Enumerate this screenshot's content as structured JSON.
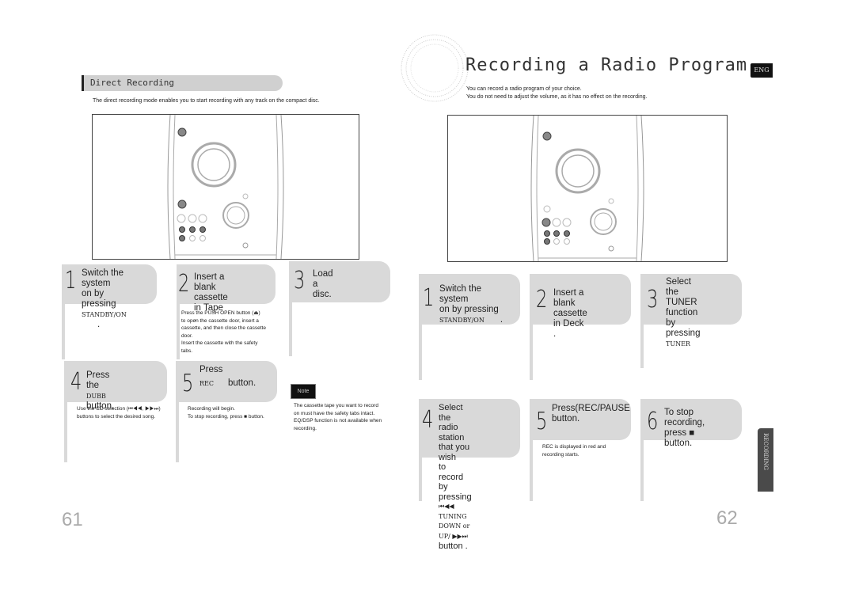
{
  "left_page": {
    "section_title": "Direct Recording",
    "intro": "The direct recording mode enables you to start recording with any track on the compact disc.",
    "steps": [
      {
        "num": "1",
        "text": [
          "Switch the system",
          "on by pressing"
        ],
        "key": "STANDBY/ON",
        "key_suffix": "."
      },
      {
        "num": "2",
        "text": [
          "Insert a blank",
          "cassette in Tape ."
        ],
        "sub": [
          "Press the PUSH OPEN button (⏏)",
          "to open the cassette door, insert a",
          "cassette, and then close the cassette",
          "door.",
          "Insert the cassette with the safety",
          "tabs."
        ]
      },
      {
        "num": "3",
        "text": [
          "Load a disc."
        ]
      },
      {
        "num": "4",
        "text": [
          "Press the",
          "button."
        ],
        "key": "DUBB",
        "sub": [
          "Use the CD selection (⏮◀◀, ▶▶⏭)",
          "buttons to select the desired song."
        ]
      },
      {
        "num": "5",
        "text": [
          "Press",
          "button."
        ],
        "key": "REC",
        "sub": [
          "Recording will begin.",
          "To stop recording, press ■ button."
        ]
      }
    ],
    "note": {
      "label": "Note",
      "lines": [
        "The cassette tape you want to record",
        "on must have the safety tabs intact.",
        "EQ/DSP function is not available when",
        " recording."
      ]
    },
    "page_number": "61"
  },
  "right_page": {
    "title": "Recording a Radio Program",
    "intro": [
      "You can record a radio program of your choice.",
      "You do not need to adjust the volume, as it has no effect on the recording."
    ],
    "lang_tab": "ENG",
    "side_tab": "RECORDING",
    "steps": [
      {
        "num": "1",
        "text": [
          "Switch the system",
          "on by pressing"
        ],
        "key": "STANDBY/ON",
        "key_suffix": "."
      },
      {
        "num": "2",
        "text": [
          "Insert a blank",
          "cassette in Deck ."
        ]
      },
      {
        "num": "3",
        "text": [
          "Select the",
          "TUNER function",
          "by pressing"
        ],
        "key": "TUNER"
      },
      {
        "num": "4",
        "text": [
          "Select the radio",
          "station that you wish",
          "to record by pressing",
          "button ."
        ],
        "key_line": "⏮◀◀ TUNING DOWN  or  UP/ ▶▶⏭"
      },
      {
        "num": "5",
        "text": [
          "Press(REC/PAUSE",
          "button."
        ],
        "close_paren": ")",
        "sub": [
          "REC is displayed in red and",
          "recording starts."
        ]
      },
      {
        "num": "6",
        "text": [
          "To stop recording,",
          "press ■ button."
        ]
      }
    ],
    "page_number": "62"
  },
  "colors": {
    "card_bg": "#d9d9d9",
    "section_bar": "#d0d0d0",
    "side_tab": "#4a4a4a",
    "page_number": "#aaaaaa"
  }
}
